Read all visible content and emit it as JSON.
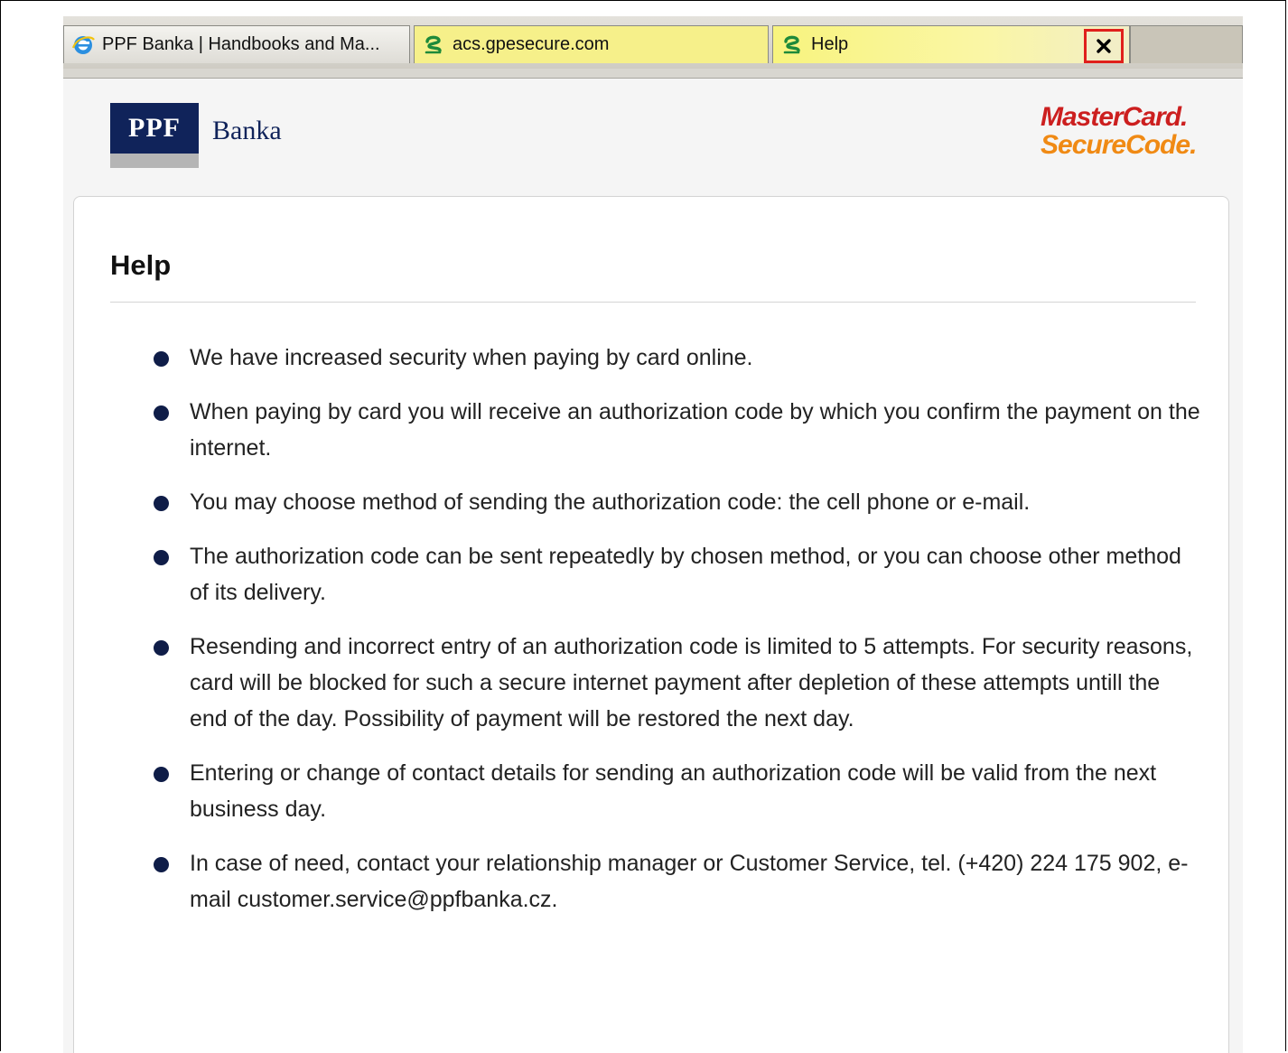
{
  "browser": {
    "tabs": [
      {
        "label": "PPF Banka | Handbooks and Ma...",
        "icon": "ie-icon"
      },
      {
        "label": "acs.gpesecure.com",
        "icon": "gpe-icon"
      },
      {
        "label": "Help",
        "icon": "gpe-icon"
      }
    ],
    "close_label": "×"
  },
  "header": {
    "ppf_logo_text": "PPF",
    "bank_name": "Banka",
    "mastercard_line1": "MasterCard.",
    "mastercard_line2": "SecureCode."
  },
  "help": {
    "title": "Help",
    "items": [
      "We have increased security when paying by card online.",
      "When paying by card you will receive an authorization code by which you confirm the payment on the internet.",
      "You may choose method of sending the authorization code: the cell phone or e-mail.",
      "The authorization code can be sent repeatedly by chosen method, or you can choose other method of its delivery.",
      "Resending and incorrect entry of an authorization code is limited to 5 attempts. For security reasons, card will be blocked for such a secure internet payment after depletion of these attempts untill the end of the day. Possibility of payment will be restored the next day.",
      "Entering or change of contact details for sending an authorization code will be valid from the next business day.",
      "In case of need, contact your relationship manager or Customer Service, tel. (+420) 224 175 902, e-mail customer.service@ppfbanka.cz."
    ]
  },
  "colors": {
    "ppf_navy": "#10235a",
    "mastercard_red": "#cc1f1f",
    "mastercard_orange": "#f08a14",
    "close_highlight": "#e0201c",
    "active_tab_yellow": "#f6f08a"
  }
}
